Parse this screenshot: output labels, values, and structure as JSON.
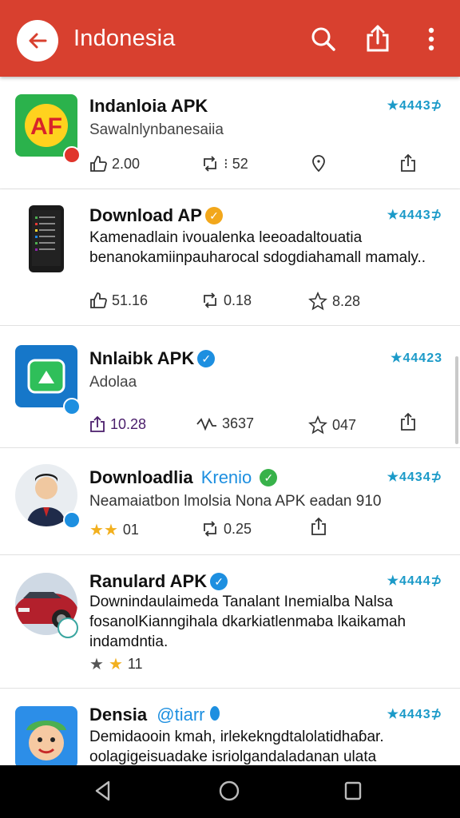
{
  "app_bar": {
    "title": "Indonesia",
    "back_icon": "arrow-left-icon",
    "search_icon": "search-icon",
    "share_icon": "share-icon",
    "menu_icon": "more-vert-icon",
    "color": "#d8402f"
  },
  "items": [
    {
      "name": "Indanloia APK",
      "tagline": "Sawalnlynbanesaiia",
      "rating": "★4443⊅",
      "stats": [
        "2.00",
        "⁝ 52",
        ""
      ]
    },
    {
      "name": "Download AP",
      "description": "Kamenadlain ivoualenka leeoadaltouatia benanokamiinpauharocal sdogdiahamall mamaly..",
      "rating": "★4443⊅",
      "stats": [
        "51.16",
        "0.18",
        "8.28"
      ]
    },
    {
      "name": "Nnlaibk APK",
      "tagline": "Adolaa",
      "rating": "★44423",
      "stats": [
        "10.28",
        "3637",
        "047"
      ]
    },
    {
      "name": "Downloadlia",
      "name_extra": "Krenio",
      "tagline": "Neamaiatbon lmolsia Nona APK eadan 910",
      "rating": "★4434⊅",
      "stats": [
        "01",
        "0.25",
        ""
      ]
    },
    {
      "name": "Ranulard APK",
      "description": "Downindaulaimeda Tanalant Inemialba Nalsa fosanolKianngihala dkarkiatlenmaba lkaikamah indamdntia.",
      "rating": "★4444⊅",
      "stats": [
        "11"
      ]
    },
    {
      "name": "Densia",
      "name_extra": "@tiarr",
      "description": "Demidaooin kmah, irlekekngdtalolatidhaɓar. oolagigeisuadake isriolgandaladanan ulata",
      "rating": "★4443⊅"
    }
  ],
  "nav": {
    "back": "nav-back-icon",
    "home": "nav-home-icon",
    "recents": "nav-recents-icon"
  },
  "colors": {
    "rating": "#1b9ac8",
    "verified": "#1d8fe0",
    "nav": "#000000"
  }
}
